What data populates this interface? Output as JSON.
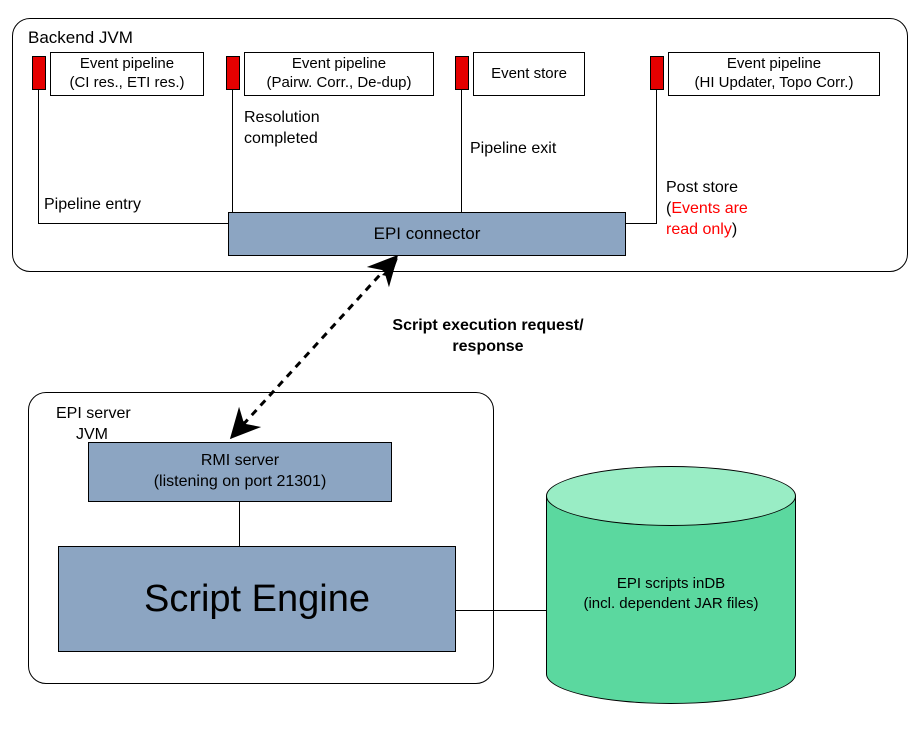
{
  "backend": {
    "title": "Backend JVM",
    "pipeline1_l1": "Event pipeline",
    "pipeline1_l2": "(CI res., ETI res.)",
    "pipeline2_l1": "Event pipeline",
    "pipeline2_l2": "(Pairw. Corr., De-dup)",
    "event_store": "Event store",
    "pipeline3_l1": "Event pipeline",
    "pipeline3_l2": "(HI Updater, Topo Corr.)",
    "pipeline_entry": "Pipeline entry",
    "resolution_completed_l1": "Resolution",
    "resolution_completed_l2": "completed",
    "pipeline_exit": "Pipeline exit",
    "post_store_l1": "Post store",
    "post_store_l2a": "(",
    "post_store_l2b": "Events are",
    "post_store_l3a": "read only",
    "post_store_l3b": ")",
    "epi_connector": "EPI connector"
  },
  "arrow_label_l1": "Script execution request/",
  "arrow_label_l2": "response",
  "epi_server": {
    "title_l1": "EPI server",
    "title_l2": "JVM",
    "rmi_l1": "RMI server",
    "rmi_l2": "(listening on port 21301)",
    "script_engine": "Script Engine"
  },
  "db": {
    "l1": "EPI scripts inDB",
    "l2": "(incl. dependent JAR files)"
  }
}
